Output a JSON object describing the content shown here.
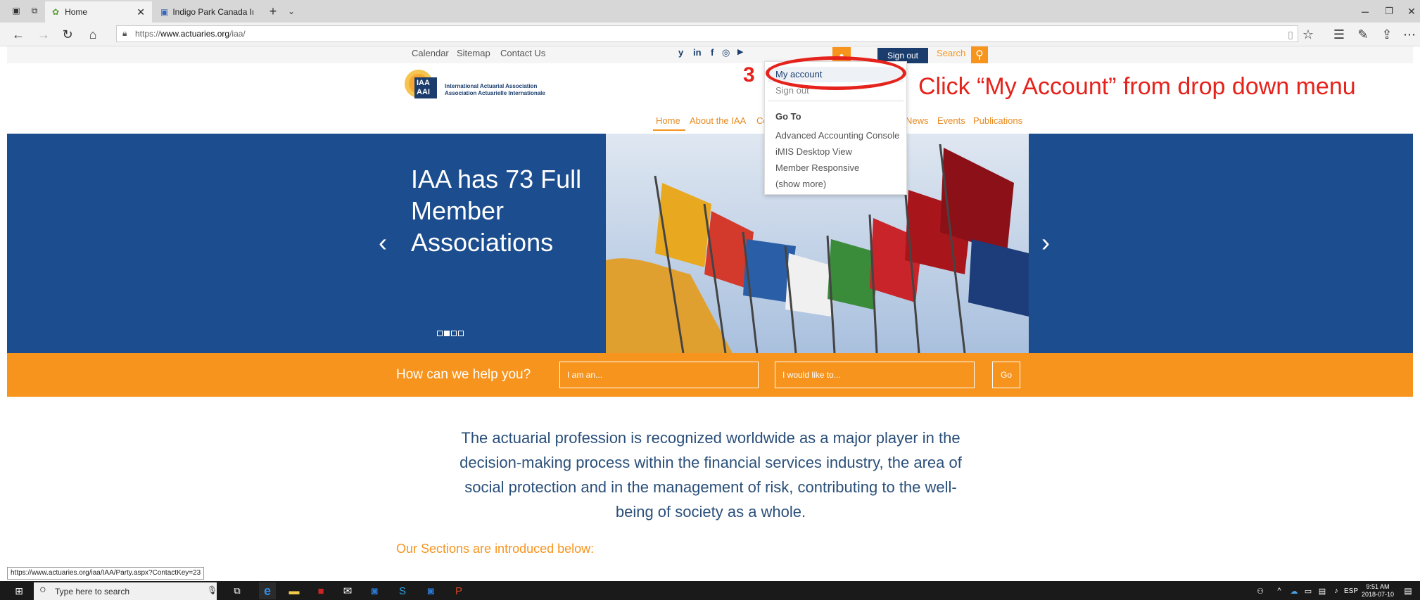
{
  "browser": {
    "tabs": [
      {
        "label": "Home"
      },
      {
        "label": "Indigo Park Canada Inc. - Pa"
      }
    ],
    "url_prefix": "https://",
    "url_host": "www.actuaries.org",
    "url_path": "/iaa/"
  },
  "site": {
    "util_links": [
      "Calendar",
      "Sitemap",
      "Contact Us"
    ],
    "social": [
      "y",
      "in",
      "f",
      "◎",
      "▶"
    ],
    "sign_out": "Sign out",
    "search_label": "Search",
    "logo_line1": "International Actuarial Association",
    "logo_line2": "Association Actuarielle Internationale",
    "logo_badge": "IAA AAI",
    "nav": [
      "Home",
      "About the IAA",
      "Co",
      "News",
      "Events",
      "Publications"
    ]
  },
  "hero": {
    "title": "IAA has 73 Full Member Associations",
    "prev": "‹",
    "next": "›"
  },
  "help": {
    "question": "How can we help you?",
    "i_am_placeholder": "I am an...",
    "i_would_placeholder": "I would like to...",
    "go": "Go"
  },
  "intro": "The actuarial profession is recognized worldwide as a major player in the decision-making process within the financial services industry, the area of social protection and in the management of risk, contributing to the well-being of society as a whole.",
  "sections_title": "Our Sections are introduced below:",
  "dropdown": {
    "my_account": "My account",
    "sign_out": "Sign out",
    "goto_label": "Go To",
    "items": [
      "Advanced Accounting Console",
      "iMIS Desktop View",
      "Member Responsive",
      "(show more)"
    ]
  },
  "annotation": {
    "step": "3",
    "text": "Click “My Account” from drop down menu"
  },
  "status_url": "https://www.actuaries.org/iaa/IAA/Party.aspx?ContactKey=23",
  "taskbar": {
    "search_placeholder": "Type here to search",
    "lang": "ESP",
    "time": "9:51 AM",
    "date": "2018-07-10"
  },
  "colors": {
    "orange": "#f7941d",
    "navy": "#1c4d8e",
    "annotation_red": "#e5221b"
  }
}
